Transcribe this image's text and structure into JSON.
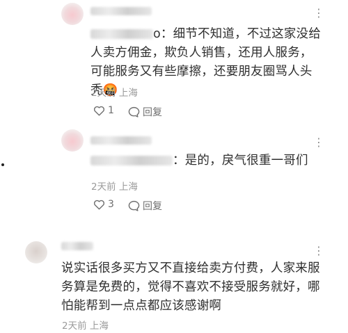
{
  "comments": [
    {
      "name_suffix": "o",
      "text_rest": "：细节不知道，不过这家没给人卖方佣金，欺负人销售，还用人服务，可能服务又有些摩擦，还要朋友圈骂人头秃🤬",
      "time": "2天前",
      "location": "上海",
      "likes": "1",
      "reply": "回复"
    },
    {
      "text_rest": "：是的，戾气很重一哥们",
      "time": "2天前",
      "location": "上海",
      "likes": "3",
      "reply": "回复"
    },
    {
      "text": "说实话很多买方又不直接给卖方付费，人家来服务算是免费的，觉得不喜欢不接受服务就好，哪怕能帮到一点点都应该感谢啊",
      "time": "2天前",
      "location": "上海"
    }
  ],
  "icons": {
    "like": "heart-outline-icon",
    "reply": "speech-bubble-icon",
    "more": "more-dots-icon"
  }
}
